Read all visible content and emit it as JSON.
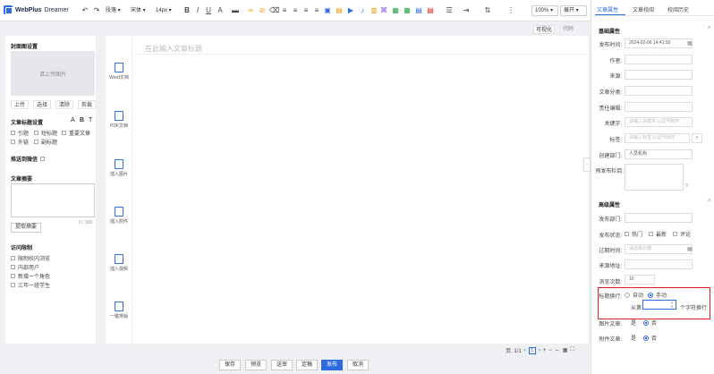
{
  "brand": {
    "name": "WebPlus",
    "sub": "Dreamer"
  },
  "toolbar": {
    "paragraph": "段落",
    "font": "宋体",
    "size": "14px",
    "zoom": "100%",
    "expand": "展开"
  },
  "editor": {
    "tabs": [
      "可视化",
      "代码"
    ],
    "title_placeholder": "在此输入文章标题",
    "vtools": [
      "Word文档",
      "PDF文档",
      "插入图片",
      "插入附件",
      "插入视频",
      "一键排版"
    ]
  },
  "left": {
    "cover_title": "封面图设置",
    "cover_placeholder": "请上传图片",
    "cover_buttons": [
      "上传",
      "选择",
      "清除",
      "剪裁"
    ],
    "title_settings": "文章标题设置",
    "title_opts": [
      "引题",
      "短标题",
      "重要文章",
      "外链",
      "副标题"
    ],
    "push": "推送到微信",
    "summary_title": "文章摘要",
    "summary_count": "0 / 300",
    "extract": "提取摘要",
    "access_title": "访问限制",
    "access_opts": [
      "限制校内浏览",
      "内部用户",
      "新增一个角色",
      "三年一班学生"
    ]
  },
  "pager": {
    "page": "页: 1/1",
    "current": "1"
  },
  "bottom": [
    "保存",
    "预览",
    "送审",
    "定稿",
    "发布",
    "取消"
  ],
  "right": {
    "tabs": [
      "文章属性",
      "文章校阅",
      "校阅历史"
    ],
    "basic": "基础属性",
    "publish_time_label": "发布时间:",
    "publish_time": "2024-02-06 14:41:50",
    "author_label": "作者:",
    "source_label": "来源:",
    "category_label": "文章分类:",
    "editor_label": "责任编辑:",
    "keywords_label": "关键字:",
    "keywords_ph": "请输入关键字,以逗号隔开",
    "tags_label": "标签:",
    "tags_ph": "请输入标签,以逗号隔开",
    "dept_label": "创建部门:",
    "dept": "人员机构",
    "pre_label": "预发布栏目:",
    "pre_count": "0",
    "advanced": "高级属性",
    "pubdept_label": "发布部门:",
    "status_label": "发布状态:",
    "status_opts": [
      "热门",
      "最新",
      "评论"
    ],
    "expire_label": "过期时间:",
    "expire_ph": "请选择日期",
    "srcurl_label": "来源地址:",
    "views_label": "浏览次数:",
    "views": "10",
    "wrap_label": "标题换行:",
    "wrap_auto": "自动",
    "wrap_manual": "手动",
    "wrap_from": "从第",
    "wrap_suffix": "个字符换行",
    "img_label": "图片文章:",
    "attach_label": "附件文章:",
    "yes": "是",
    "no": "否"
  }
}
